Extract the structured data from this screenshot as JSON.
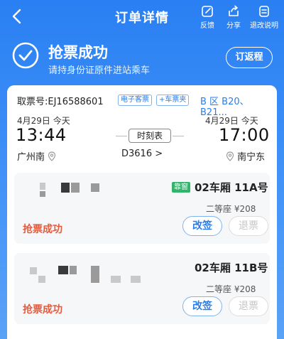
{
  "header": {
    "title": "订单详情",
    "actions": [
      {
        "label": "反馈",
        "icon": "feedback-edit-icon"
      },
      {
        "label": "分享",
        "icon": "share-icon"
      },
      {
        "label": "退改说明",
        "icon": "document-icon"
      }
    ]
  },
  "status": {
    "title": "抢票成功",
    "subtitle": "请持身份证原件进站乘车",
    "return_button": "订返程"
  },
  "order": {
    "order_no": "取票号:EJ16588601",
    "tags": [
      "电子客票",
      "+车票夹"
    ],
    "seat_area": "B 区 B20、B21..."
  },
  "trip": {
    "depart_date": "4月29日  今天",
    "arrive_date": "4月29日  今天",
    "depart_time": "13:44",
    "arrive_time": "17:00",
    "depart_station": "广州南",
    "arrive_station": "南宁东",
    "schedule_label": "时刻表",
    "train_no": "D3616 >"
  },
  "passengers": [
    {
      "window_tag": "靠窗",
      "seat": "02车厢 11A号",
      "seat_class": "二等座  ¥208",
      "status": "抢票成功",
      "change_label": "改签",
      "refund_label": "退票"
    },
    {
      "seat": "02车厢 11B号",
      "seat_class": "二等座  ¥208",
      "status": "抢票成功",
      "change_label": "改签",
      "refund_label": "退票"
    }
  ],
  "colors": {
    "primary_blue": "#2b7de9",
    "header_gradient_top": "#2a7ff2",
    "success_red": "#e35b3d",
    "window_tag_green": "#33b36b"
  }
}
